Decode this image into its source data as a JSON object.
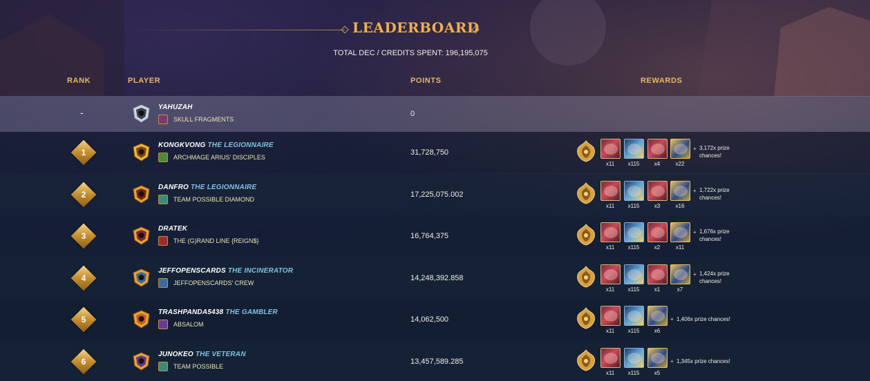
{
  "header": {
    "title": "LEADERBOARD",
    "total_spent": "TOTAL DEC / CREDITS SPENT: 196,195,075"
  },
  "columns": {
    "rank": "RANK",
    "player": "PLAYER",
    "points": "POINTS",
    "rewards": "REWARDS"
  },
  "current_user": {
    "rank": "-",
    "name": "YAHUZAH",
    "title": "",
    "guild": "SKULL FRAGMENTS",
    "points": "0"
  },
  "rows": [
    {
      "rank": "1",
      "name": "KONGKVONG",
      "title": "THE LEGIONNAIRE",
      "guild": "ARCHMAGE ARIUS' DISCIPLES",
      "points": "31,728,750",
      "rewards": [
        "x11",
        "x115",
        "x4",
        "x22"
      ],
      "chances_line1": "3,172x prize",
      "chances_line2": "chances!"
    },
    {
      "rank": "2",
      "name": "DANFRO",
      "title": "THE LEGIONNAIRE",
      "guild": "TEAM POSSIBLE DIAMOND",
      "points": "17,225,075.002",
      "rewards": [
        "x11",
        "x115",
        "x3",
        "x16"
      ],
      "chances_line1": "1,722x prize",
      "chances_line2": "chances!"
    },
    {
      "rank": "3",
      "name": "DRATEK",
      "title": "",
      "guild": "THE (G)RAND LINE {REIGN$}",
      "points": "16,764,375",
      "rewards": [
        "x11",
        "x115",
        "x2",
        "x11"
      ],
      "chances_line1": "1,676x prize",
      "chances_line2": "chances!"
    },
    {
      "rank": "4",
      "name": "JEFFOPENSCARDS",
      "title": "THE INCINERATOR",
      "guild": "JEFFOPENSCARDS' CREW",
      "points": "14,248,392.858",
      "rewards": [
        "x11",
        "x115",
        "x1",
        "x7"
      ],
      "chances_line1": "1,424x prize",
      "chances_line2": "chances!"
    },
    {
      "rank": "5",
      "name": "TRASHPANDA5438",
      "title": "THE GAMBLER",
      "guild": "ABSALOM",
      "points": "14,062,500",
      "rewards": [
        "x11",
        "x115",
        "x6"
      ],
      "chances_line1": "1,406x prize chances!",
      "chances_line2": ""
    },
    {
      "rank": "6",
      "name": "JUNOKEO",
      "title": "THE VETERAN",
      "guild": "TEAM POSSIBLE",
      "points": "13,457,589.285",
      "rewards": [
        "x11",
        "x115",
        "x5"
      ],
      "chances_line1": "1,345x prize chances!",
      "chances_line2": ""
    }
  ],
  "icons": {
    "rank_badge": "gold-diamond-icon",
    "avatar": "league-shield-icon",
    "guild": "guild-banner-icon",
    "emblem": "golden-emblem-icon",
    "card": "reward-card-icon"
  },
  "colors": {
    "accent_gold": "#f0b04a",
    "player_title": "#7fc3e0",
    "guild_text": "#e9e4b8"
  }
}
